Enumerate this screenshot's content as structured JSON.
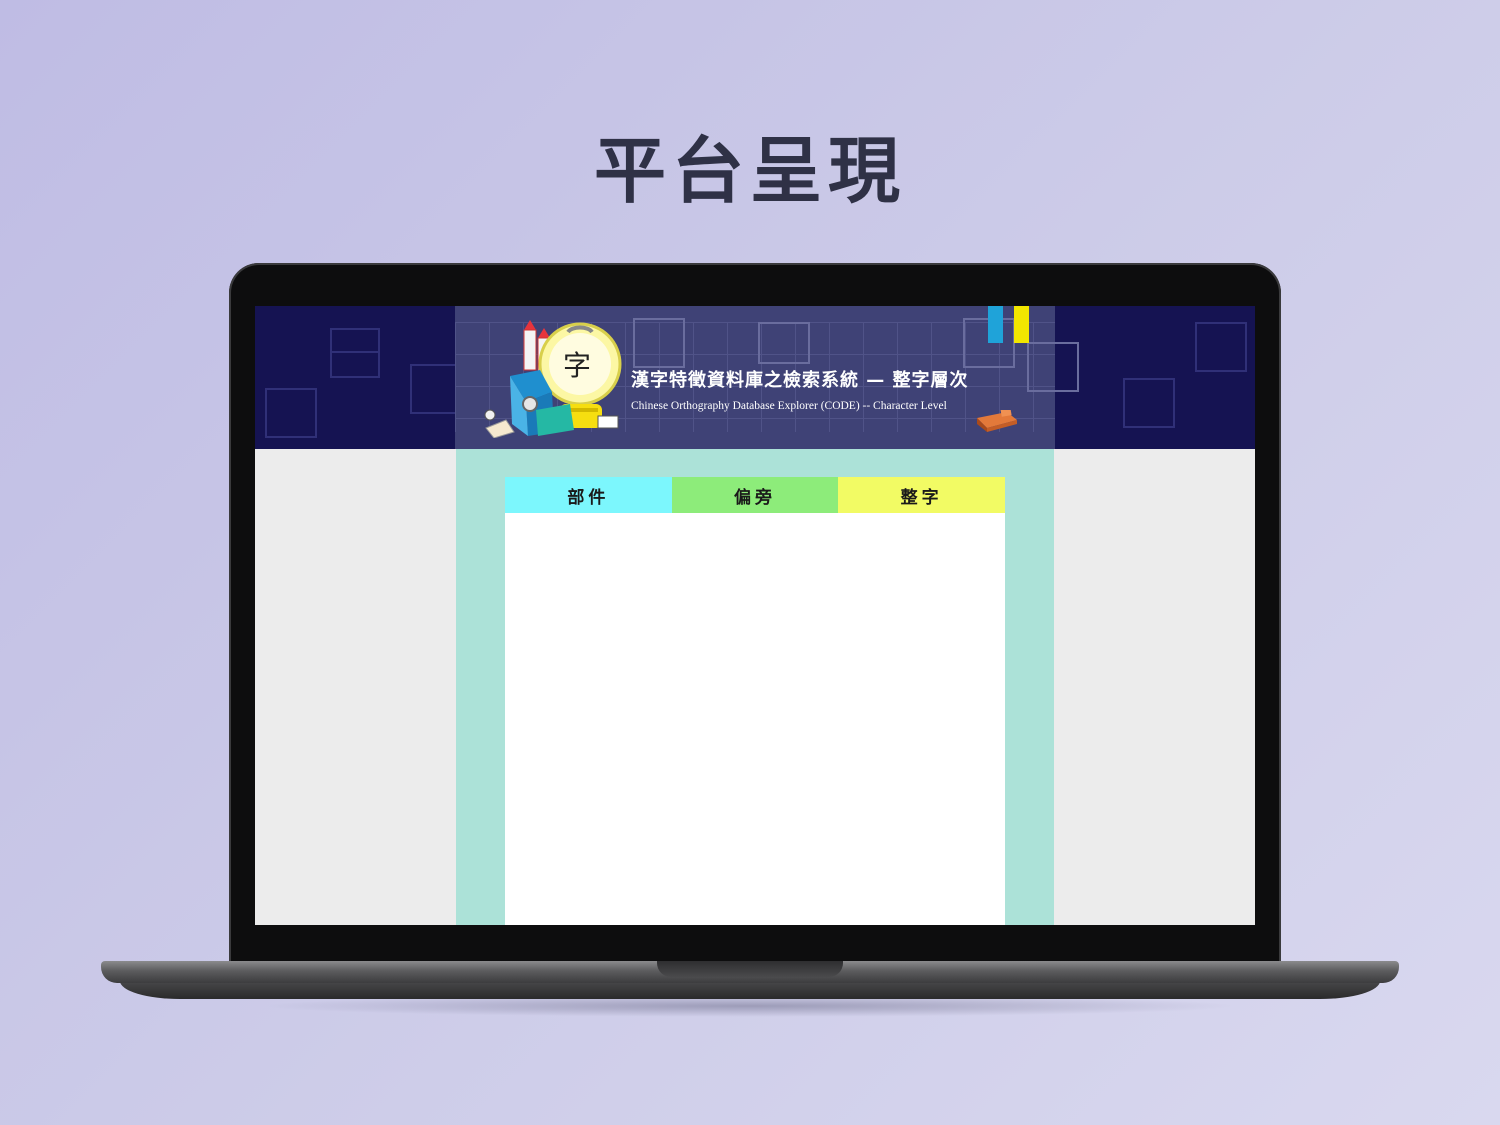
{
  "page": {
    "title": "平台呈現"
  },
  "banner": {
    "title_zh": "漢字特徵資料庫之檢索系統 — 整字層次",
    "title_en": "Chinese Orthography Database Explorer (CODE) -- Character Level",
    "mascot_char": "字",
    "colors": {
      "outer": "#151352",
      "inner": "#3f4276",
      "stripe_blue": "#1fa3d9",
      "stripe_yellow": "#f2e600"
    }
  },
  "tabs": [
    {
      "label": "部件",
      "color": "#7cf7fd"
    },
    {
      "label": "偏旁",
      "color": "#8dec7a"
    },
    {
      "label": "整字",
      "color": "#f2fb64"
    }
  ],
  "content": {
    "background": "#ace2d8"
  }
}
